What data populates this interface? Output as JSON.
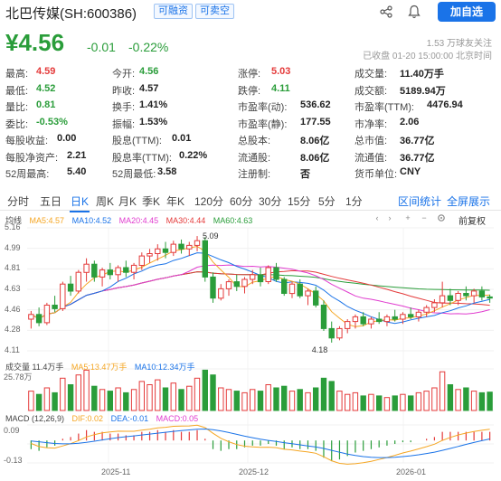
{
  "header": {
    "title": "北巴传媒(SH:600386)",
    "tag1": "可融资",
    "tag2": "可卖空",
    "add_button": "加自选"
  },
  "quote": {
    "price": "¥4.56",
    "change": "-0.01",
    "change_pct": "-0.22%",
    "followers": "1.53 万球友关注",
    "close_info": "已收盘 01-20 15:00:00 北京时间"
  },
  "stats": [
    [
      {
        "l": "最高:",
        "v": "4.59",
        "c": "red"
      },
      {
        "l": "今开:",
        "v": "4.56",
        "c": "green"
      },
      {
        "l": "涨停:",
        "v": "5.03",
        "c": "red"
      },
      {
        "l": "成交量:",
        "v": "11.40万手",
        "c": "dark"
      }
    ],
    [
      {
        "l": "最低:",
        "v": "4.52",
        "c": "green"
      },
      {
        "l": "昨收:",
        "v": "4.57",
        "c": "dark"
      },
      {
        "l": "跌停:",
        "v": "4.11",
        "c": "green"
      },
      {
        "l": "成交额:",
        "v": "5189.94万",
        "c": "dark"
      }
    ],
    [
      {
        "l": "量比:",
        "v": "0.81",
        "c": "green"
      },
      {
        "l": "换手:",
        "v": "1.41%",
        "c": "dark"
      },
      {
        "l": "市盈率(动):",
        "v": "536.62",
        "c": "dark"
      },
      {
        "l": "市盈率(TTM):",
        "v": "4476.94",
        "c": "dark"
      }
    ],
    [
      {
        "l": "委比:",
        "v": "-0.53%",
        "c": "green"
      },
      {
        "l": "振幅:",
        "v": "1.53%",
        "c": "dark"
      },
      {
        "l": "市盈率(静):",
        "v": "177.55",
        "c": "dark"
      },
      {
        "l": "市净率:",
        "v": "2.06",
        "c": "dark"
      }
    ],
    [
      {
        "l": "每股收益:",
        "v": "0.00",
        "c": "dark"
      },
      {
        "l": "股息(TTM):",
        "v": "0.01",
        "c": "dark"
      },
      {
        "l": "总股本:",
        "v": "8.06亿",
        "c": "dark"
      },
      {
        "l": "总市值:",
        "v": "36.77亿",
        "c": "dark"
      }
    ],
    [
      {
        "l": "每股净资产:",
        "v": "2.21",
        "c": "dark"
      },
      {
        "l": "股息率(TTM):",
        "v": "0.22%",
        "c": "dark"
      },
      {
        "l": "流通股:",
        "v": "8.06亿",
        "c": "dark"
      },
      {
        "l": "流通值:",
        "v": "36.77亿",
        "c": "dark"
      }
    ],
    [
      {
        "l": "52周最高:",
        "v": "5.40",
        "c": "dark"
      },
      {
        "l": "52周最低:",
        "v": "3.58",
        "c": "dark"
      },
      {
        "l": "注册制:",
        "v": "否",
        "c": "dark"
      },
      {
        "l": "货币单位:",
        "v": "CNY",
        "c": "dark"
      }
    ]
  ],
  "tabs": [
    "分时",
    "五日",
    "日K",
    "周K",
    "月K",
    "季K",
    "年K",
    "120分",
    "60分",
    "30分",
    "15分",
    "5分",
    "1分"
  ],
  "active_tab": "日K",
  "tab_links": {
    "range_stats": "区间统计",
    "fullscreen": "全屏展示"
  },
  "ma_legend": {
    "label": "均线",
    "ma5": "MA5:4.57",
    "ma10": "MA10:4.52",
    "ma20": "MA20:4.45",
    "ma30": "MA30:4.44",
    "ma60": "MA60:4.63",
    "adjust": "前复权"
  },
  "price_axis": [
    "5.16",
    "4.99",
    "4.81",
    "4.63",
    "4.46",
    "4.28",
    "4.11"
  ],
  "annotations": {
    "high": "5.09",
    "low": "4.18"
  },
  "vol_legend": {
    "label": "成交量 11.4万手",
    "ma5": "MA5:13.47万手",
    "ma10": "MA10:12.34万手"
  },
  "vol_axis": [
    "25.78万"
  ],
  "macd_legend": {
    "label": "MACD (12,26,9)",
    "dif": "DIF:0.02",
    "dea": "DEA:-0.01",
    "macd": "MACD:0.05"
  },
  "macd_axis": [
    "0.09",
    "-0.13"
  ],
  "dates": [
    "2025-11",
    "2025-12",
    "2026-01"
  ],
  "colors": {
    "up": "#e43a3a",
    "down": "#2a9d3a",
    "ma5": "#f5a623",
    "ma10": "#1a73e8",
    "ma20": "#e03ccf",
    "ma30": "#e43a3a",
    "ma60": "#2a9d3a",
    "accent": "#1a73e8"
  },
  "icons": [
    "share-icon",
    "bell-icon",
    "chevron-left-icon",
    "chevron-right-icon",
    "zoom-in-icon",
    "zoom-out-icon",
    "settings-icon"
  ],
  "chart_data": {
    "type": "candlestick",
    "series_name": "日K",
    "candles": [
      [
        4.38,
        4.45,
        4.3,
        4.42
      ],
      [
        4.42,
        4.48,
        4.32,
        4.35
      ],
      [
        4.35,
        4.52,
        4.33,
        4.5
      ],
      [
        4.5,
        4.58,
        4.44,
        4.47
      ],
      [
        4.47,
        4.7,
        4.45,
        4.68
      ],
      [
        4.68,
        4.75,
        4.58,
        4.62
      ],
      [
        4.62,
        4.8,
        4.6,
        4.78
      ],
      [
        4.78,
        4.9,
        4.7,
        4.85
      ],
      [
        4.85,
        4.88,
        4.7,
        4.74
      ],
      [
        4.74,
        4.82,
        4.66,
        4.8
      ],
      [
        4.8,
        4.86,
        4.72,
        4.76
      ],
      [
        4.76,
        4.84,
        4.7,
        4.82
      ],
      [
        4.82,
        4.88,
        4.74,
        4.78
      ],
      [
        4.78,
        4.86,
        4.72,
        4.84
      ],
      [
        4.84,
        4.95,
        4.8,
        4.92
      ],
      [
        4.92,
        4.98,
        4.86,
        4.94
      ],
      [
        4.94,
        5.02,
        4.88,
        4.98
      ],
      [
        4.98,
        5.04,
        4.9,
        4.95
      ],
      [
        4.95,
        5.05,
        4.92,
        5.02
      ],
      [
        5.02,
        5.06,
        4.94,
        4.98
      ],
      [
        4.98,
        5.04,
        4.92,
        5.01
      ],
      [
        5.01,
        5.09,
        4.96,
        5.05
      ],
      [
        5.05,
        5.08,
        4.7,
        4.74
      ],
      [
        4.74,
        4.78,
        4.52,
        4.56
      ],
      [
        4.56,
        4.68,
        4.54,
        4.64
      ],
      [
        4.64,
        4.72,
        4.58,
        4.7
      ],
      [
        4.7,
        4.76,
        4.62,
        4.66
      ],
      [
        4.66,
        4.74,
        4.6,
        4.72
      ],
      [
        4.72,
        4.8,
        4.68,
        4.76
      ],
      [
        4.76,
        4.82,
        4.66,
        4.7
      ],
      [
        4.7,
        4.84,
        4.68,
        4.82
      ],
      [
        4.82,
        4.86,
        4.7,
        4.72
      ],
      [
        4.72,
        4.74,
        4.58,
        4.6
      ],
      [
        4.6,
        4.7,
        4.56,
        4.68
      ],
      [
        4.68,
        4.72,
        4.56,
        4.58
      ],
      [
        4.58,
        4.64,
        4.5,
        4.62
      ],
      [
        4.62,
        4.66,
        4.48,
        4.5
      ],
      [
        4.5,
        4.54,
        4.28,
        4.3
      ],
      [
        4.3,
        4.36,
        4.18,
        4.22
      ],
      [
        4.22,
        4.32,
        4.2,
        4.3
      ],
      [
        4.3,
        4.38,
        4.26,
        4.36
      ],
      [
        4.36,
        4.42,
        4.3,
        4.4
      ],
      [
        4.4,
        4.44,
        4.32,
        4.34
      ],
      [
        4.34,
        4.4,
        4.3,
        4.38
      ],
      [
        4.38,
        4.44,
        4.34,
        4.36
      ],
      [
        4.36,
        4.42,
        4.32,
        4.4
      ],
      [
        4.4,
        4.46,
        4.36,
        4.38
      ],
      [
        4.38,
        4.44,
        4.34,
        4.42
      ],
      [
        4.42,
        4.48,
        4.38,
        4.4
      ],
      [
        4.4,
        4.46,
        4.36,
        4.44
      ],
      [
        4.44,
        4.5,
        4.4,
        4.48
      ],
      [
        4.48,
        4.55,
        4.44,
        4.52
      ],
      [
        4.52,
        4.7,
        4.48,
        4.58
      ],
      [
        4.58,
        4.64,
        4.5,
        4.54
      ],
      [
        4.54,
        4.62,
        4.5,
        4.6
      ],
      [
        4.6,
        4.66,
        4.54,
        4.58
      ],
      [
        4.58,
        4.64,
        4.52,
        4.62
      ],
      [
        4.62,
        4.66,
        4.54,
        4.57
      ],
      [
        4.57,
        4.59,
        4.52,
        4.56
      ]
    ],
    "volume": [
      12,
      10,
      14,
      11,
      20,
      16,
      22,
      25,
      15,
      13,
      12,
      14,
      11,
      13,
      18,
      16,
      19,
      14,
      17,
      13,
      15,
      20,
      25,
      22,
      14,
      13,
      12,
      11,
      13,
      12,
      16,
      14,
      15,
      12,
      13,
      11,
      14,
      20,
      18,
      12,
      10,
      11,
      9,
      10,
      9,
      8,
      9,
      10,
      9,
      11,
      12,
      14,
      24,
      16,
      13,
      14,
      12,
      11,
      11.4
    ],
    "macd": [
      -0.05,
      -0.06,
      -0.04,
      -0.03,
      0.01,
      0.02,
      0.04,
      0.06,
      0.05,
      0.05,
      0.04,
      0.04,
      0.03,
      0.03,
      0.05,
      0.05,
      0.06,
      0.05,
      0.06,
      0.05,
      0.05,
      0.06,
      0.01,
      -0.05,
      -0.06,
      -0.05,
      -0.05,
      -0.04,
      -0.03,
      -0.03,
      -0.02,
      -0.03,
      -0.05,
      -0.04,
      -0.05,
      -0.05,
      -0.06,
      -0.1,
      -0.12,
      -0.11,
      -0.09,
      -0.07,
      -0.06,
      -0.05,
      -0.04,
      -0.03,
      -0.02,
      -0.01,
      -0.01,
      0.0,
      0.01,
      0.02,
      0.05,
      0.05,
      0.05,
      0.05,
      0.05,
      0.05,
      0.05
    ],
    "price_ylim": [
      4.11,
      5.16
    ],
    "volume_ylim": [
      0,
      25.78
    ],
    "macd_ylim": [
      -0.13,
      0.09
    ]
  }
}
